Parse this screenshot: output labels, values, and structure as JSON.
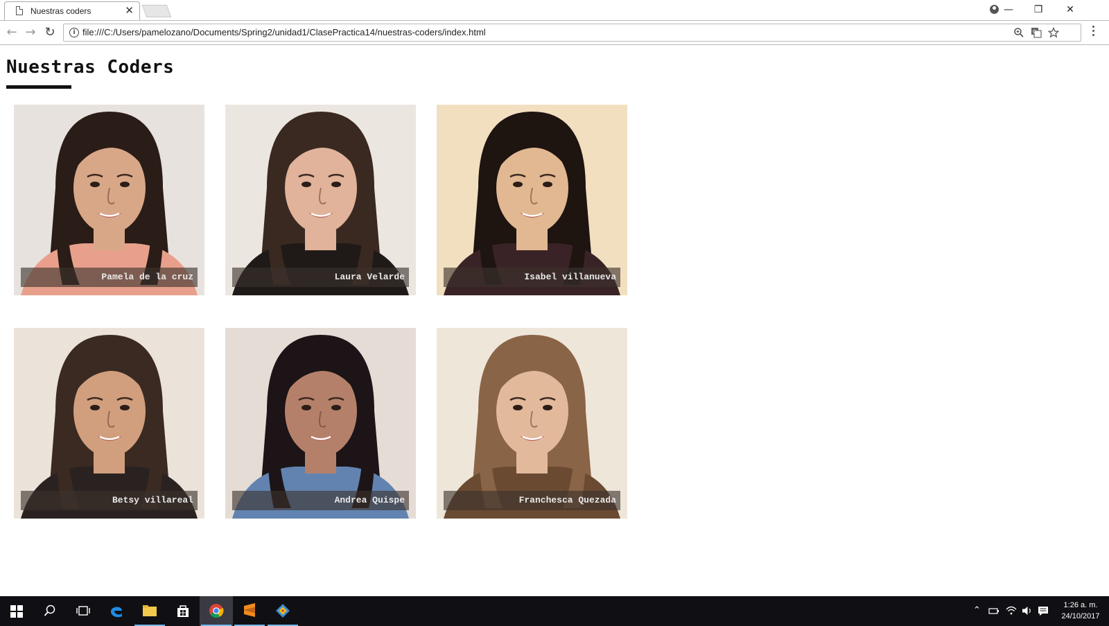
{
  "browser": {
    "tab_title": "Nuestras coders",
    "tab_close": "✕",
    "url": "file:///C:/Users/pamelozano/Documents/Spring2/unidad1/ClasePractica14/nuestras-coders/index.html",
    "back": "←",
    "forward": "→",
    "reload": "↻",
    "minimize": "—",
    "restore": "❐",
    "close": "✕"
  },
  "page": {
    "title": "Nuestras Coders",
    "coders": [
      {
        "name": "Pamela de la cruz",
        "bg": "#e8e2de",
        "skin": "#d8a788",
        "hair": "#2a1c17",
        "shirt": "#e8a08c"
      },
      {
        "name": "Laura Velarde",
        "bg": "#ece6e0",
        "skin": "#e0b39a",
        "hair": "#3a2920",
        "shirt": "#1f1a18"
      },
      {
        "name": "Isabel villanueva",
        "bg": "#f1dfc0",
        "skin": "#e1b891",
        "hair": "#1e1410",
        "shirt": "#3a2326"
      },
      {
        "name": "Betsy villareal",
        "bg": "#ebe3da",
        "skin": "#d19f7e",
        "hair": "#3a2a22",
        "shirt": "#2a2220"
      },
      {
        "name": "Andrea Quispe",
        "bg": "#e6dcd6",
        "skin": "#b5806a",
        "hair": "#1c1416",
        "shirt": "#6283b0"
      },
      {
        "name": "Franchesca Quezada",
        "bg": "#efe6da",
        "skin": "#e3b99c",
        "hair": "#8a6446",
        "shirt": "#6b4a32"
      }
    ]
  },
  "taskbar": {
    "time": "1:26 a. m.",
    "date": "24/10/2017"
  }
}
